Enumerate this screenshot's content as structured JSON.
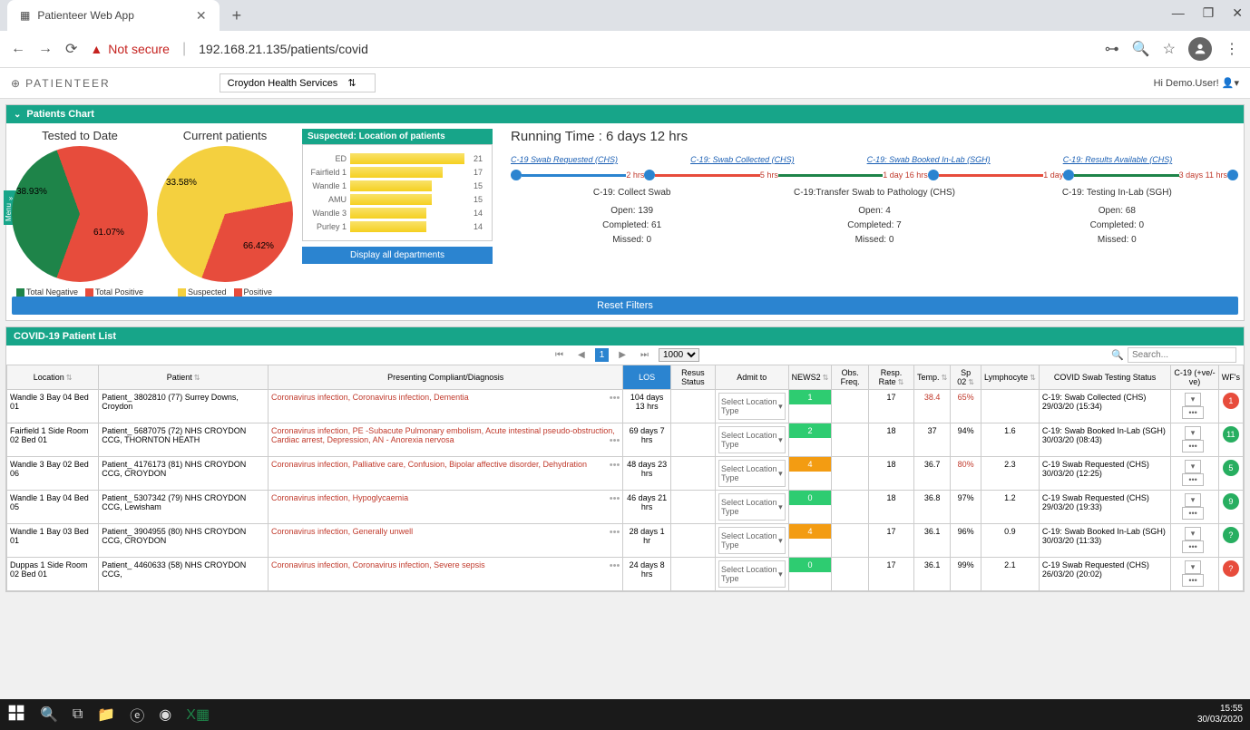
{
  "browser": {
    "tab_title": "Patienteer Web App",
    "not_secure": "Not secure",
    "url": "192.168.21.135/patients/covid"
  },
  "window_controls": {
    "minimize": "—",
    "maximize": "❐",
    "close": "✕"
  },
  "app": {
    "logo": "PATIENTEER",
    "org": "Croydon Health Services",
    "user_greet": "Hi Demo.User!"
  },
  "side_menu": "Menu",
  "panels": {
    "charts_title": "Patients Chart",
    "patient_list_title": "COVID-19 Patient List"
  },
  "pie1": {
    "title": "Tested to Date",
    "slice1_label": "38.93%",
    "slice2_label": "61.07%",
    "legend": [
      "Total Negative",
      "Total Positive"
    ],
    "colors": [
      "#1e8449",
      "#e74c3c"
    ]
  },
  "pie2": {
    "title": "Current patients",
    "slice1_label": "33.58%",
    "slice2_label": "66.42%",
    "legend": [
      "Suspected",
      "Positive"
    ],
    "colors": [
      "#f4d03f",
      "#e74c3c"
    ]
  },
  "bar": {
    "title": "Suspected: Location of patients",
    "button": "Display all departments"
  },
  "timeline": {
    "running_time": "Running Time : 6 days 12 hrs",
    "links": [
      "C-19 Swab Requested (CHS)",
      "C-19: Swab Collected (CHS)",
      "C-19: Swab Booked In-Lab (SGH)",
      "C-19: Results Available (CHS)"
    ],
    "durations": [
      "2 hrs",
      "5 hrs",
      "1 day 16 hrs",
      "1 day",
      "3 days 11 hrs"
    ],
    "stages": [
      {
        "name": "C-19: Collect Swab",
        "open": "Open: 139",
        "completed": "Completed: 61",
        "missed": "Missed: 0"
      },
      {
        "name": "C-19:Transfer Swab to Pathology (CHS)",
        "open": "Open: 4",
        "completed": "Completed: 7",
        "missed": "Missed: 0"
      },
      {
        "name": "C-19: Testing In-Lab (SGH)",
        "open": "Open: 68",
        "completed": "Completed: 0",
        "missed": "Missed: 0"
      }
    ]
  },
  "reset_filters": "Reset Filters",
  "pager": {
    "page": "1",
    "page_size": "1000",
    "search_placeholder": "Search..."
  },
  "grid": {
    "headers": {
      "location": "Location",
      "patient": "Patient",
      "diagnosis": "Presenting Compliant/Diagnosis",
      "los": "LOS",
      "resus": "Resus Status",
      "admit": "Admit to",
      "news2": "NEWS2",
      "obs": "Obs. Freq.",
      "resp": "Resp. Rate",
      "temp": "Temp.",
      "spo2": "Sp 02",
      "lymph": "Lymphocyte",
      "swab": "COVID Swab Testing Status",
      "c19": "C-19 (+ve/-ve)",
      "wf": "WF's"
    },
    "admit_placeholder": "Select Location Type",
    "rows": [
      {
        "location": "Wandle 3 Bay 04 Bed 01",
        "patient": "Patient_ 3802810 (77) Surrey Downs, Croydon",
        "diagnosis": "Coronavirus infection, Coronavirus infection, Dementia",
        "los": "104 days 13 hrs",
        "news2": "1",
        "news2_color": "#2ecc71",
        "resp": "17",
        "temp": "38.4",
        "temp_red": true,
        "spo2": "65%",
        "spo2_red": true,
        "lymph": "",
        "swab": "C-19: Swab Collected (CHS) 29/03/20 (15:34)",
        "wf": "1",
        "wf_color": "#e74c3c"
      },
      {
        "location": "Fairfield 1 Side Room 02 Bed 01",
        "patient": "Patient_ 5687075 (72) NHS CROYDON CCG, THORNTON HEATH",
        "diagnosis": "Coronavirus infection, PE -Subacute Pulmonary embolism, Acute intestinal pseudo-obstruction, Cardiac arrest, Depression, AN - Anorexia nervosa",
        "los": "69 days 7 hrs",
        "news2": "2",
        "news2_color": "#2ecc71",
        "resp": "18",
        "temp": "37",
        "spo2": "94%",
        "lymph": "1.6",
        "swab": "C-19: Swab Booked In-Lab (SGH) 30/03/20 (08:43)",
        "wf": "11",
        "wf_color": "#27ae60"
      },
      {
        "location": "Wandle 3 Bay 02 Bed 06",
        "patient": "Patient_ 4176173 (81) NHS CROYDON CCG, CROYDON",
        "diagnosis": "Coronavirus infection, Palliative care, Confusion, Bipolar affective disorder, Dehydration",
        "los": "48 days 23 hrs",
        "news2": "4",
        "news2_color": "#f39c12",
        "resp": "18",
        "temp": "36.7",
        "spo2": "80%",
        "spo2_red": true,
        "lymph": "2.3",
        "swab": "C-19 Swab Requested (CHS) 30/03/20 (12:25)",
        "wf": "5",
        "wf_color": "#27ae60"
      },
      {
        "location": "Wandle 1 Bay 04 Bed 05",
        "patient": "Patient_ 5307342 (79) NHS CROYDON CCG, Lewisham",
        "diagnosis": "Coronavirus infection, Hypoglycaemia",
        "los": "46 days 21 hrs",
        "news2": "0",
        "news2_color": "#2ecc71",
        "resp": "18",
        "temp": "36.8",
        "spo2": "97%",
        "lymph": "1.2",
        "swab": "C-19 Swab Requested (CHS) 29/03/20 (19:33)",
        "wf": "9",
        "wf_color": "#27ae60"
      },
      {
        "location": "Wandle 1 Bay 03 Bed 01",
        "patient": "Patient_ 3904955 (80) NHS CROYDON CCG, CROYDON",
        "diagnosis": "Coronavirus infection, Generally unwell",
        "los": "28 days 1 hr",
        "news2": "4",
        "news2_color": "#f39c12",
        "resp": "17",
        "temp": "36.1",
        "spo2": "96%",
        "lymph": "0.9",
        "swab": "C-19: Swab Booked In-Lab (SGH) 30/03/20 (11:33)",
        "wf": "?",
        "wf_color": "#27ae60"
      },
      {
        "location": "Duppas 1 Side Room 02 Bed 01",
        "patient": "Patient_ 4460633 (58) NHS CROYDON CCG,",
        "diagnosis": "Coronavirus infection, Coronavirus infection, Severe sepsis",
        "los": "24 days 8 hrs",
        "news2": "0",
        "news2_color": "#2ecc71",
        "resp": "17",
        "temp": "36.1",
        "spo2": "99%",
        "lymph": "2.1",
        "swab": "C-19 Swab Requested (CHS) 26/03/20 (20:02)",
        "wf": "?",
        "wf_color": "#e74c3c"
      }
    ]
  },
  "clock": {
    "time": "15:55",
    "date": "30/03/2020"
  },
  "chart_data": [
    {
      "type": "pie",
      "title": "Tested to Date",
      "series": [
        {
          "name": "Total Negative",
          "value": 38.93,
          "color": "#1e8449"
        },
        {
          "name": "Total Positive",
          "value": 61.07,
          "color": "#e74c3c"
        }
      ]
    },
    {
      "type": "pie",
      "title": "Current patients",
      "series": [
        {
          "name": "Suspected",
          "value": 66.42,
          "color": "#f4d03f"
        },
        {
          "name": "Positive",
          "value": 33.58,
          "color": "#e74c3c"
        }
      ]
    },
    {
      "type": "bar",
      "title": "Suspected: Location of patients",
      "categories": [
        "ED",
        "Fairfield 1",
        "Wandle 1",
        "AMU",
        "Wandle 3",
        "Purley 1"
      ],
      "values": [
        21,
        17,
        15,
        15,
        14,
        14
      ],
      "xlim": [
        0,
        22
      ]
    }
  ]
}
